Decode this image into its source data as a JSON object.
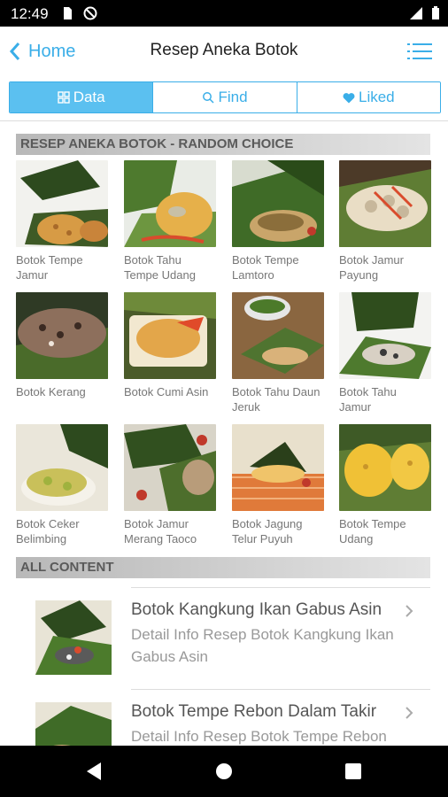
{
  "status": {
    "time": "12:49"
  },
  "nav": {
    "back_label": "Home",
    "title": "Resep Aneka Botok"
  },
  "tabs": [
    {
      "label": "Data",
      "icon": "grid-icon"
    },
    {
      "label": "Find",
      "icon": "search-icon"
    },
    {
      "label": "Liked",
      "icon": "heart-icon"
    }
  ],
  "random_header": "RESEP ANEKA BOTOK - RANDOM CHOICE",
  "grid": [
    {
      "label": "Botok Tempe Jamur"
    },
    {
      "label": "Botok Tahu Tempe Udang"
    },
    {
      "label": "Botok Tempe Lamtoro"
    },
    {
      "label": "Botok Jamur Payung"
    },
    {
      "label": "Botok Kerang"
    },
    {
      "label": "Botok Cumi Asin"
    },
    {
      "label": "Botok Tahu Daun Jeruk"
    },
    {
      "label": "Botok Tahu Jamur"
    },
    {
      "label": "Botok Ceker Belimbing"
    },
    {
      "label": "Botok Jamur Merang Taoco"
    },
    {
      "label": "Botok Jagung Telur Puyuh"
    },
    {
      "label": "Botok Tempe Udang"
    }
  ],
  "all_header": "ALL CONTENT",
  "list": [
    {
      "title": "Botok Kangkung Ikan Gabus Asin",
      "subtitle": "Detail Info Resep Botok Kangkung Ikan Gabus Asin"
    },
    {
      "title": "Botok Tempe Rebon Dalam Takir",
      "subtitle": "Detail Info Resep Botok Tempe Rebon"
    }
  ]
}
